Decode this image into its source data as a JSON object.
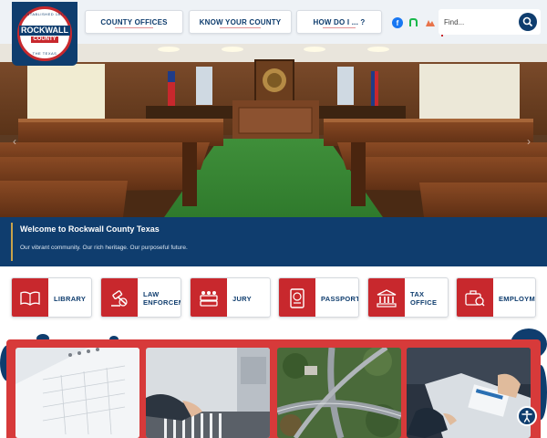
{
  "logo": {
    "name": "ROCKWALL",
    "sub": "COUNTY",
    "top_text": "ESTABLISHED 1873",
    "bottom_text": "THE TEXAS"
  },
  "nav": {
    "items": [
      {
        "label": "COUNTY OFFICES"
      },
      {
        "label": "KNOW YOUR COUNTY"
      },
      {
        "label": "HOW DO I ... ?"
      }
    ]
  },
  "social": {
    "icons": [
      "facebook-icon",
      "nextdoor-icon",
      "apple-icon"
    ]
  },
  "search": {
    "placeholder": "Find..."
  },
  "hero": {
    "prev_label": "‹",
    "next_label": "›"
  },
  "welcome": {
    "title": "Welcome to Rockwall County Texas",
    "subtitle": "Our vibrant community. Our rich heritage. Our purposeful future."
  },
  "quick_links": [
    {
      "label": "LIBRARY",
      "icon": "book-icon"
    },
    {
      "label": "LAW\nENFORCEM",
      "icon": "gavel-icon"
    },
    {
      "label": "JURY",
      "icon": "jury-icon"
    },
    {
      "label": "PASSPORT",
      "icon": "passport-icon"
    },
    {
      "label": "TAX\nOFFICE",
      "icon": "courthouse-icon"
    },
    {
      "label": "EMPLOYMEI",
      "icon": "employment-icon"
    }
  ],
  "colors": {
    "navy": "#0f3d6e",
    "red": "#c8282d",
    "accent_gold": "#c8a24a"
  }
}
